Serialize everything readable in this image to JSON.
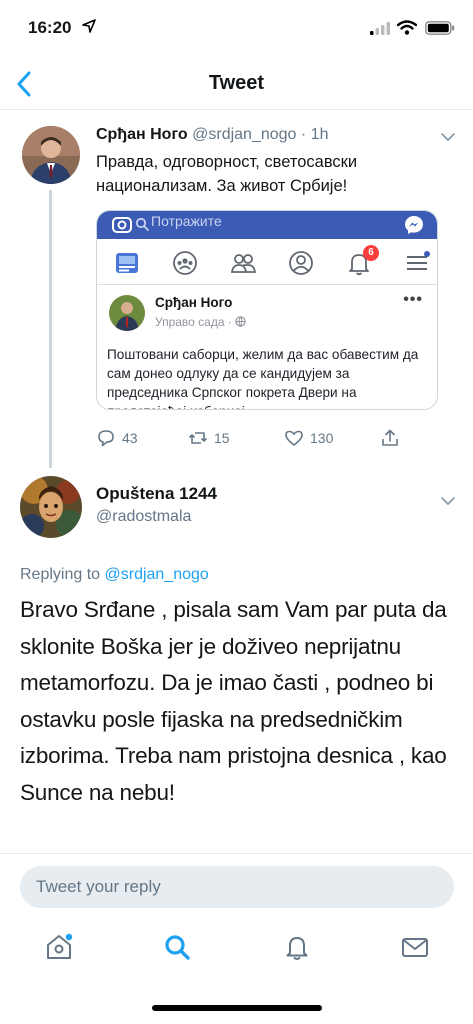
{
  "status_bar": {
    "time": "16:20"
  },
  "nav": {
    "title": "Tweet"
  },
  "tweet": {
    "name": "Срђан Ного",
    "handle": "@srdjan_nogo",
    "separator": "·",
    "age": "1h",
    "text": "Правда, одговорност, светосавски национализам. За живот Србије!",
    "actions": {
      "replies": "43",
      "retweets": "15",
      "likes": "130"
    }
  },
  "fb_screenshot": {
    "search_placeholder": "Потражите",
    "notification_count": "6",
    "post_author": "Срђан Ного",
    "post_time": "Управо сада ·",
    "post_menu": "•••",
    "post_text": "Поштовани саборци, желим да вас обавестим да сам донео одлуку да се кандидујем за председника Српског покрета Двери на предстојећој изборној"
  },
  "reply": {
    "name": "Opuštena 1244",
    "handle": "@radostmala",
    "replying_label": "Replying to",
    "replying_to": "@srdjan_nogo",
    "text": "Bravo Srđane , pisala sam Vam par puta da sklonite Boška  jer je doživeo neprijatnu metamorfozu. Da je imao časti , podneo bi ostavku posle fijaska na predsedničkim izborima. Treba nam pristojna desnica , kao Sunce na nebu!"
  },
  "compose": {
    "placeholder": "Tweet your reply"
  },
  "colors": {
    "twitter_blue": "#1da1f2",
    "facebook_blue": "#3b5bb5",
    "muted": "#657786"
  },
  "tabs": [
    "home-icon",
    "search-icon",
    "notifications-icon",
    "messages-icon"
  ]
}
